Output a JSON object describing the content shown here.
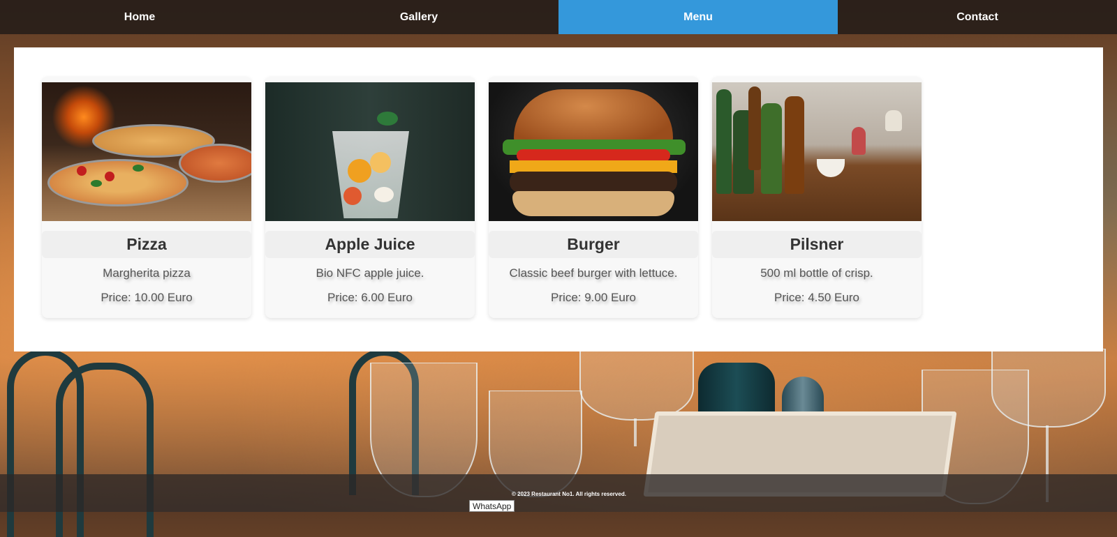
{
  "nav": {
    "items": [
      {
        "label": "Home"
      },
      {
        "label": "Gallery"
      },
      {
        "label": "Menu"
      },
      {
        "label": "Contact"
      }
    ],
    "active_index": 2,
    "active_color": "#3498db"
  },
  "menu": {
    "items": [
      {
        "title": "Pizza",
        "description": "Margherita pizza",
        "price": "Price: 10.00 Euro",
        "image_alt": "pizza-image"
      },
      {
        "title": "Apple Juice",
        "description": "Bio NFC apple juice.",
        "price": "Price: 6.00 Euro",
        "image_alt": "juice-image"
      },
      {
        "title": "Burger",
        "description": "Classic beef burger with lettuce.",
        "price": "Price: 9.00 Euro",
        "image_alt": "burger-image"
      },
      {
        "title": "Pilsner",
        "description": "500 ml bottle of crisp.",
        "price": "Price: 4.50 Euro",
        "image_alt": "beer-image"
      }
    ]
  },
  "footer": {
    "copyright": "© 2023 Restaurant No1. All rights reserved."
  },
  "tooltip": {
    "label": "WhatsApp"
  }
}
